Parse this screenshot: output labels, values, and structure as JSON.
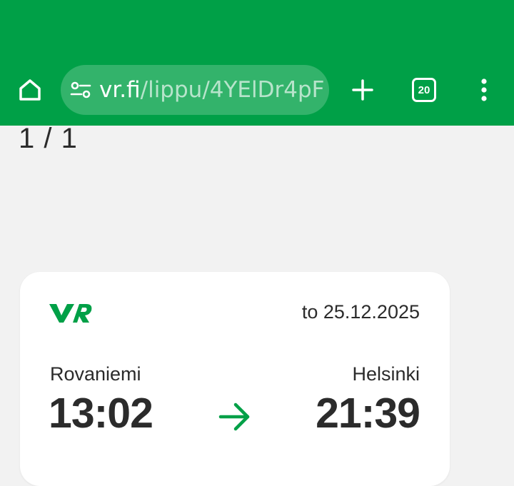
{
  "browser": {
    "url_domain": "vr.fi",
    "url_path": "/lippu/4YElDr4pF",
    "tab_count": "20",
    "colors": {
      "toolbar": "#00a047"
    },
    "icons": [
      "home-icon",
      "site-settings-icon",
      "plus-icon",
      "tab-switcher-icon",
      "more-vert-icon"
    ]
  },
  "page": {
    "counter": "1 / 1"
  },
  "ticket": {
    "logo": "VR",
    "date": "to 25.12.2025",
    "origin": {
      "name": "Rovaniemi",
      "time": "13:02"
    },
    "destination": {
      "name": "Helsinki",
      "time": "21:39"
    },
    "colors": {
      "brand": "#00a047"
    }
  }
}
